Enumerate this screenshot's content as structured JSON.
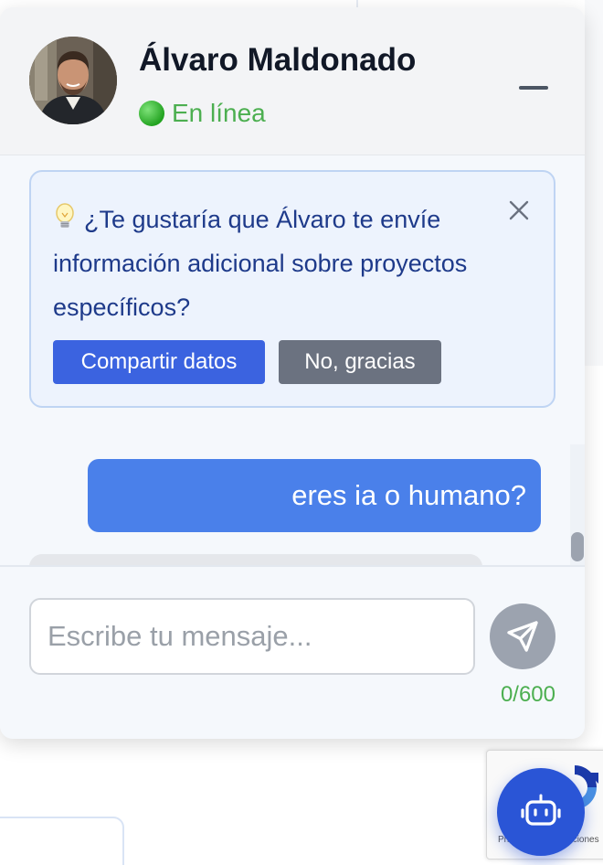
{
  "header": {
    "name": "Álvaro Maldonado",
    "status": "En línea",
    "avatar_icon": "avatar-photo",
    "minimize_icon": "minimize-icon"
  },
  "suggestion": {
    "icon": "lightbulb-icon",
    "text": "¿Te gustaría que Álvaro te envíe información adicional sobre proyectos específicos?",
    "accept_label": "Compartir datos",
    "decline_label": "No, gracias",
    "close_icon": "close-icon"
  },
  "messages": [
    {
      "from": "user",
      "text": "eres ia o humano?"
    },
    {
      "from": "bot",
      "text": ""
    }
  ],
  "composer": {
    "placeholder": "Escribe tu mensaje...",
    "value": "",
    "char_count": "0/600",
    "send_icon": "send-icon"
  },
  "recaptcha": {
    "text": "Privacidad - Condiciones"
  },
  "launcher": {
    "icon": "robot-icon"
  },
  "colors": {
    "accent": "#3b63e0",
    "user_bubble": "#4a80ea",
    "status_green": "#4caf50",
    "launcher": "#2a55d6"
  }
}
